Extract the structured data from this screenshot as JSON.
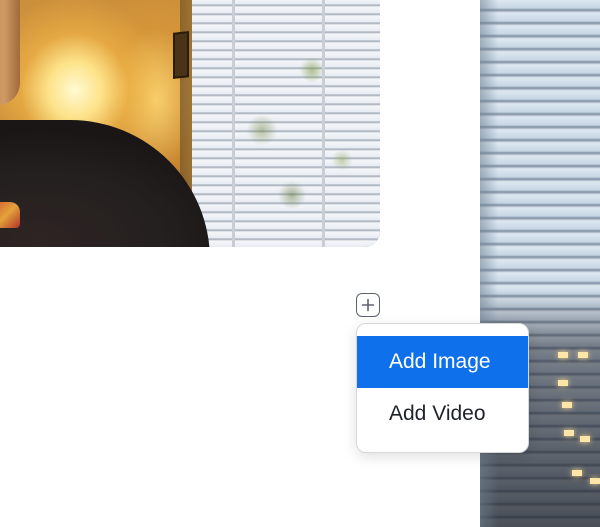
{
  "menu": {
    "items": [
      {
        "label": "Add Image",
        "selected": true
      },
      {
        "label": "Add Video",
        "selected": false
      }
    ],
    "highlight_color": "#0e71eb"
  },
  "add_button": {
    "icon": "plus-icon"
  }
}
